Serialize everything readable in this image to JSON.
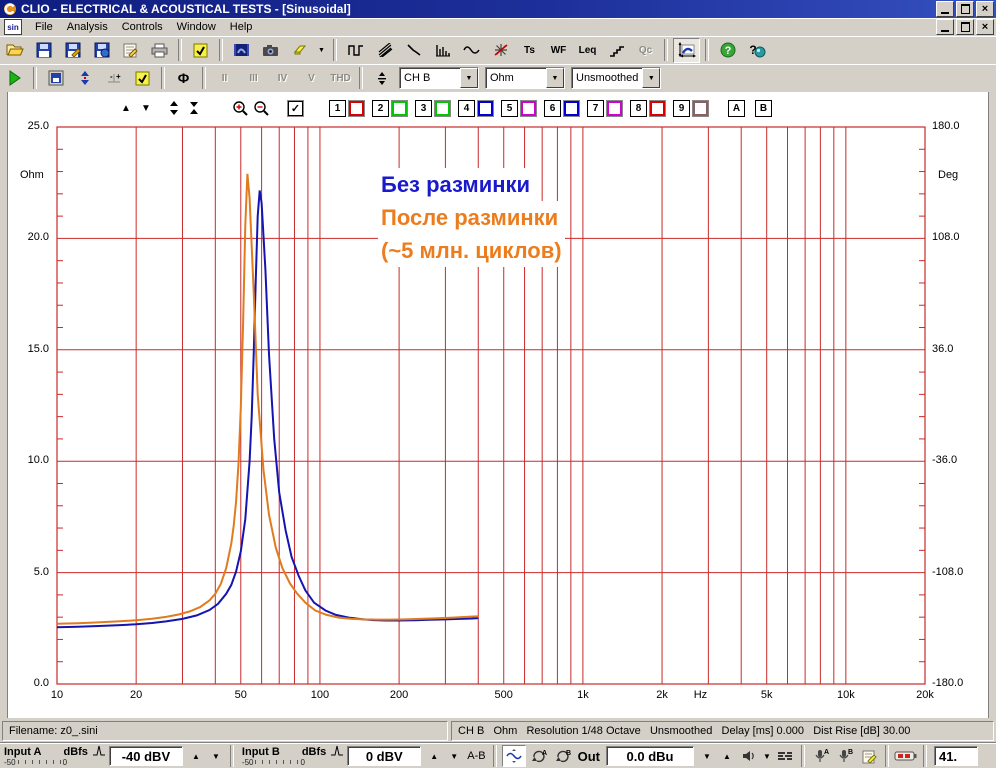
{
  "window": {
    "title": "CLIO - ELECTRICAL & ACOUSTICAL TESTS - [Sinusoidal]",
    "doc_icon_label": "sin"
  },
  "menu": {
    "items": [
      "File",
      "Analysis",
      "Controls",
      "Window",
      "Help"
    ]
  },
  "toolbar1": {
    "ts": "Ts",
    "wf": "WF",
    "leq": "Leq",
    "qc": "Qc"
  },
  "toolbar2": {
    "harmonics": [
      "II",
      "III",
      "IV",
      "V",
      "THD"
    ],
    "phase": "Φ",
    "channel": "CH B",
    "unit": "Ohm",
    "smoothing": "Unsmoothed"
  },
  "graph_toolbar": {
    "master_check": "✓",
    "a_label": "A",
    "b_label": "B",
    "slots": [
      {
        "n": "1",
        "color": "#d80000"
      },
      {
        "n": "2",
        "color": "#00c800"
      },
      {
        "n": "3",
        "color": "#00c800"
      },
      {
        "n": "4",
        "color": "#0000d0"
      },
      {
        "n": "5",
        "color": "#d000d0"
      },
      {
        "n": "6",
        "color": "#0000d0"
      },
      {
        "n": "7",
        "color": "#d000d0"
      },
      {
        "n": "8",
        "color": "#d80000"
      },
      {
        "n": "9",
        "color": "#8b6060"
      }
    ]
  },
  "chart_data": {
    "type": "line",
    "x_scale": "log",
    "xlim": [
      10,
      20000
    ],
    "ylim_left": [
      0,
      25
    ],
    "ylim_right": [
      -180,
      180
    ],
    "grid": true,
    "grid_color": "#c92a2a",
    "xlabel": "Hz",
    "ylabel_left": "Ohm",
    "ylabel_right": "Deg",
    "x_ticks": [
      {
        "f": 10,
        "label": "10"
      },
      {
        "f": 20,
        "label": "20"
      },
      {
        "f": 50,
        "label": "50"
      },
      {
        "f": 100,
        "label": "100"
      },
      {
        "f": 200,
        "label": "200"
      },
      {
        "f": 500,
        "label": "500"
      },
      {
        "f": 1000,
        "label": "1k"
      },
      {
        "f": 2000,
        "label": "2k"
      },
      {
        "f": 2800,
        "label": "Hz"
      },
      {
        "f": 5000,
        "label": "5k"
      },
      {
        "f": 10000,
        "label": "10k"
      },
      {
        "f": 20000,
        "label": "20k"
      }
    ],
    "y_ticks_left": [
      {
        "v": 25,
        "label": "25.0"
      },
      {
        "v": 20,
        "label": "20.0"
      },
      {
        "v": 15,
        "label": "15.0"
      },
      {
        "v": 10,
        "label": "10.0"
      },
      {
        "v": 5,
        "label": "5.0"
      },
      {
        "v": 0,
        "label": "0.0"
      }
    ],
    "y_ticks_right": [
      {
        "v": 180,
        "label": "180.0"
      },
      {
        "v": 108,
        "label": "108.0"
      },
      {
        "v": 36,
        "label": "36.0"
      },
      {
        "v": -36,
        "label": "-36.0"
      },
      {
        "v": -108,
        "label": "-108.0"
      },
      {
        "v": -180,
        "label": "-180.0"
      }
    ],
    "series": [
      {
        "name": "Без разминки",
        "color": "#1414b0",
        "x": [
          10,
          12,
          14,
          17,
          20,
          23,
          26,
          30,
          34,
          38,
          41,
          44,
          46,
          48,
          50,
          52,
          54,
          55,
          56,
          57,
          58,
          59,
          60,
          62,
          64,
          67,
          70,
          74,
          78,
          83,
          88,
          95,
          105,
          115,
          130,
          145,
          160,
          180,
          200,
          230,
          260,
          300,
          340,
          380,
          400
        ],
        "y": [
          2.55,
          2.57,
          2.6,
          2.64,
          2.68,
          2.74,
          2.81,
          2.92,
          3.08,
          3.32,
          3.6,
          4.05,
          4.45,
          5.05,
          5.95,
          7.4,
          10.0,
          12.0,
          14.8,
          18.2,
          21.0,
          22.15,
          21.6,
          18.6,
          14.8,
          11.0,
          8.6,
          6.9,
          5.7,
          4.85,
          4.2,
          3.65,
          3.3,
          3.1,
          2.97,
          2.91,
          2.87,
          2.85,
          2.85,
          2.86,
          2.88,
          2.9,
          2.92,
          2.94,
          2.96
        ]
      },
      {
        "name": "После разминки (~5 млн. циклов)",
        "color": "#e07b1e",
        "x": [
          10,
          12,
          14,
          17,
          20,
          23,
          26,
          29,
          32,
          35,
          38,
          40,
          42,
          44,
          46,
          47,
          48,
          49,
          50,
          51,
          52,
          53,
          54,
          56,
          58,
          61,
          64,
          68,
          72,
          77,
          82,
          88,
          96,
          106,
          118,
          132,
          148,
          165,
          185,
          210,
          240,
          280,
          320,
          360,
          400
        ],
        "y": [
          2.7,
          2.73,
          2.76,
          2.81,
          2.86,
          2.93,
          3.01,
          3.12,
          3.26,
          3.45,
          3.75,
          4.05,
          4.5,
          5.2,
          6.3,
          7.1,
          8.2,
          9.9,
          12.4,
          16.2,
          20.6,
          22.9,
          21.8,
          17.6,
          13.0,
          9.6,
          7.6,
          6.1,
          5.2,
          4.5,
          4.05,
          3.65,
          3.3,
          3.1,
          2.98,
          2.92,
          2.9,
          2.89,
          2.89,
          2.9,
          2.92,
          2.95,
          2.98,
          3.01,
          3.04
        ]
      }
    ]
  },
  "annotations": {
    "lines": [
      {
        "text": "Без разминки",
        "color": "#1a1acc"
      },
      {
        "text": "После разминки",
        "color": "#ec7d1f"
      },
      {
        "text": "(~5 млн. циклов)",
        "color": "#ec7d1f"
      }
    ]
  },
  "status_bar": {
    "filename": "Filename: z0_.sini",
    "info": "CH B   Ohm   Resolution 1/48 Octave   Unsmoothed   Delay [ms] 0.000   Dist Rise [dB] 30.00"
  },
  "bottom_bar": {
    "input_a_label": "Input A",
    "input_b_label": "Input B",
    "dbfs_label": "dBfs",
    "scale_min": "-50",
    "scale_max": "0",
    "input_a_value": "-40 dBV",
    "input_b_value": "0 dBV",
    "link_label": "A-B",
    "out_label": "Out",
    "out_value": "0.0 dBu",
    "corner_value": "41."
  }
}
